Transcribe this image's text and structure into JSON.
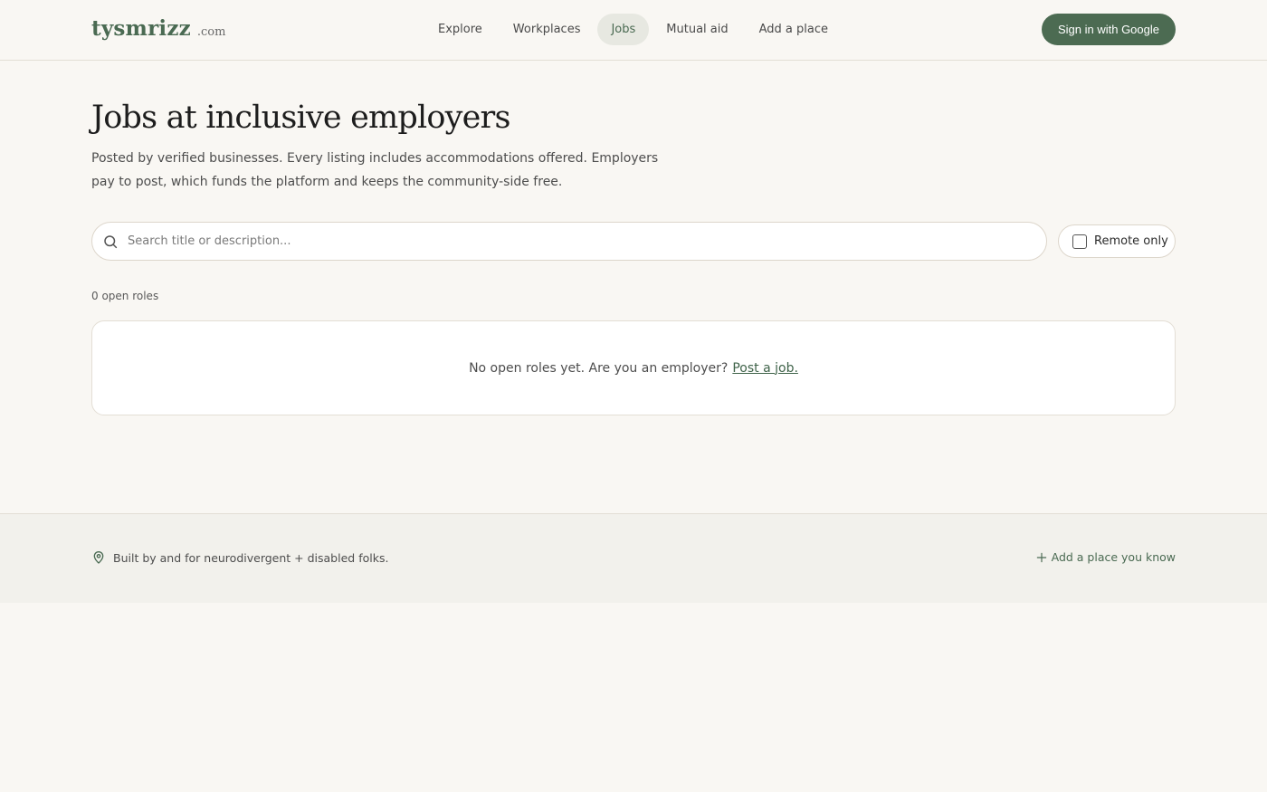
{
  "header": {
    "brand_name": "tysmrizz",
    "brand_tld": ".com",
    "nav": [
      {
        "label": "Explore",
        "active": false
      },
      {
        "label": "Workplaces",
        "active": false
      },
      {
        "label": "Jobs",
        "active": true
      },
      {
        "label": "Mutual aid",
        "active": false
      },
      {
        "label": "Add a place",
        "active": false
      }
    ],
    "signin_label": "Sign in with Google"
  },
  "main": {
    "title": "Jobs at inclusive employers",
    "intro": "Posted by verified businesses. Every listing includes accommodations offered. Employers pay to post, which funds the platform and keeps the community-side free.",
    "search": {
      "placeholder": "Search title or description...",
      "value": ""
    },
    "remote_filter": {
      "label": "Remote only",
      "checked": false
    },
    "roles_count": "0 open roles",
    "empty_state": {
      "text": "No open roles yet. Are you an employer?",
      "link_label": "Post a job."
    }
  },
  "footer": {
    "tagline": "Built by and for neurodivergent + disabled folks.",
    "add_place_label": "Add a place you know"
  },
  "colors": {
    "accent": "#4c6b52",
    "background": "#f9f7f3",
    "footer_background": "#f2f1ec",
    "active_nav_background": "#e7e8e1"
  },
  "icons": {
    "search": "search-icon",
    "pin": "map-pin-icon",
    "plus": "plus-icon"
  }
}
